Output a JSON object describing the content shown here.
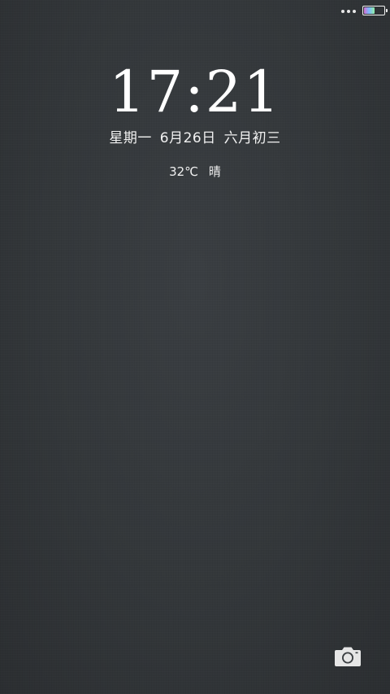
{
  "status_bar": {
    "battery_level": 0.55,
    "icons": [
      "overflow-dots-icon",
      "battery-icon"
    ]
  },
  "lock_screen": {
    "time": "17:21",
    "date": {
      "weekday": "星期一",
      "date": "6月26日",
      "lunar": "六月初三"
    },
    "weather": {
      "temperature": "32℃",
      "condition": "晴"
    },
    "camera_shortcut_icon": "camera-icon"
  },
  "colors": {
    "background": "#33373a",
    "text": "#ffffff"
  }
}
